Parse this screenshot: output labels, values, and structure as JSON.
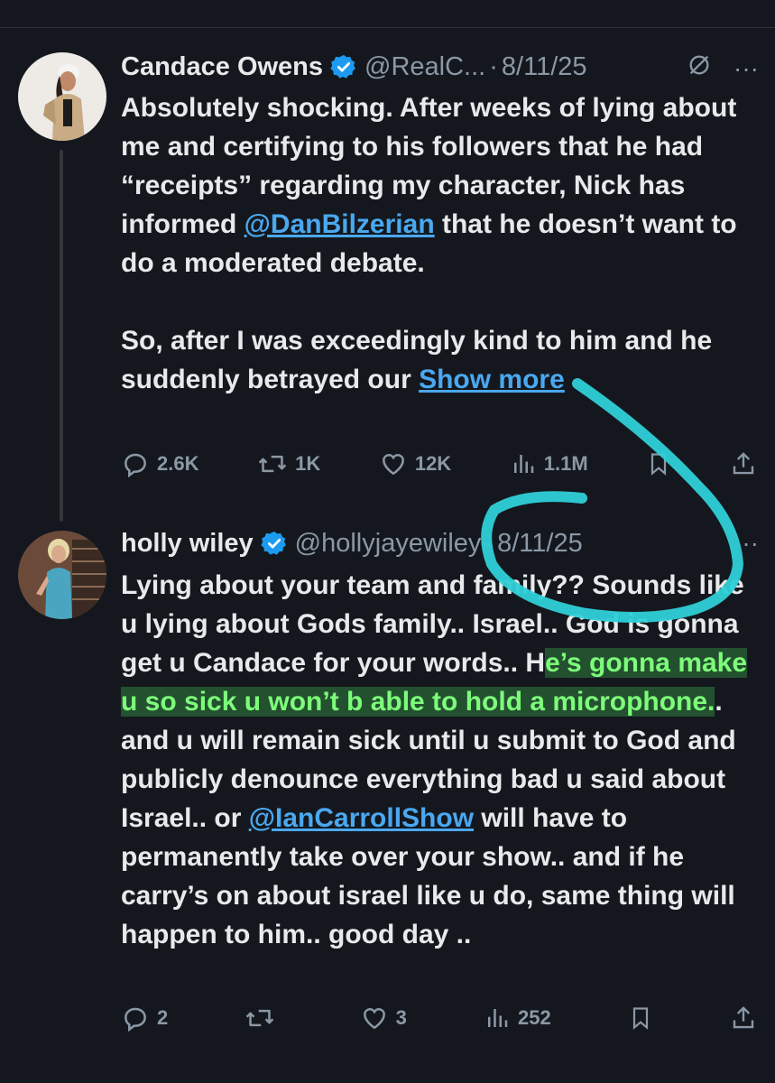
{
  "tweets": [
    {
      "author": "Candace Owens",
      "handle": "@RealC...",
      "separator": "·",
      "date": "8/11/25",
      "menu": "···",
      "body_p1_a": "Absolutely shocking. After weeks of lying about me and certifying to his followers that he had “receipts” regarding my character, Nick has informed ",
      "mention": "@DanBilzerian",
      "body_p1_b": " that he doesn’t want to do a moderated debate.",
      "body_p2": "So, after I was exceedingly kind to him and he suddenly betrayed our ",
      "show_more": "Show more",
      "stats": {
        "replies": "2.6K",
        "reposts": "1K",
        "likes": "12K",
        "views": "1.1M"
      }
    },
    {
      "author": "holly wiley",
      "handle": "@hollyjayewiley",
      "separator": "·",
      "date": "8/11/25",
      "menu": "··",
      "body_a": "Lying about your team and family?? Sounds like u lying about Gods family.. Israel.. God is gonna get u Candace for your words.. H",
      "body_highlight": "e’s gonna make u so sick u won’t b able to hold a microphone.",
      "body_b": ". and u will remain sick until u submit to God and publicly denounce everything bad u said about Israel.. or ",
      "mention": "@IanCarrollShow",
      "body_c": "  will have to permanently take over your show.. and if he carry’s on about israel like u do, same thing will happen to him.. good day ..",
      "stats": {
        "replies": "2",
        "reposts": "",
        "likes": "3",
        "views": "252"
      }
    }
  ],
  "colors": {
    "background": "#14181e",
    "text": "#e7e9ea",
    "muted": "#8b98a5",
    "link": "#4aa8f0",
    "verified": "#1d9bf0",
    "scribble": "#2fd0d8",
    "highlight": "#7dfc7a"
  },
  "icons": [
    "verified-badge-icon",
    "grok-icon",
    "more-icon",
    "reply-icon",
    "repost-icon",
    "like-icon",
    "views-icon",
    "bookmark-icon",
    "share-icon"
  ]
}
